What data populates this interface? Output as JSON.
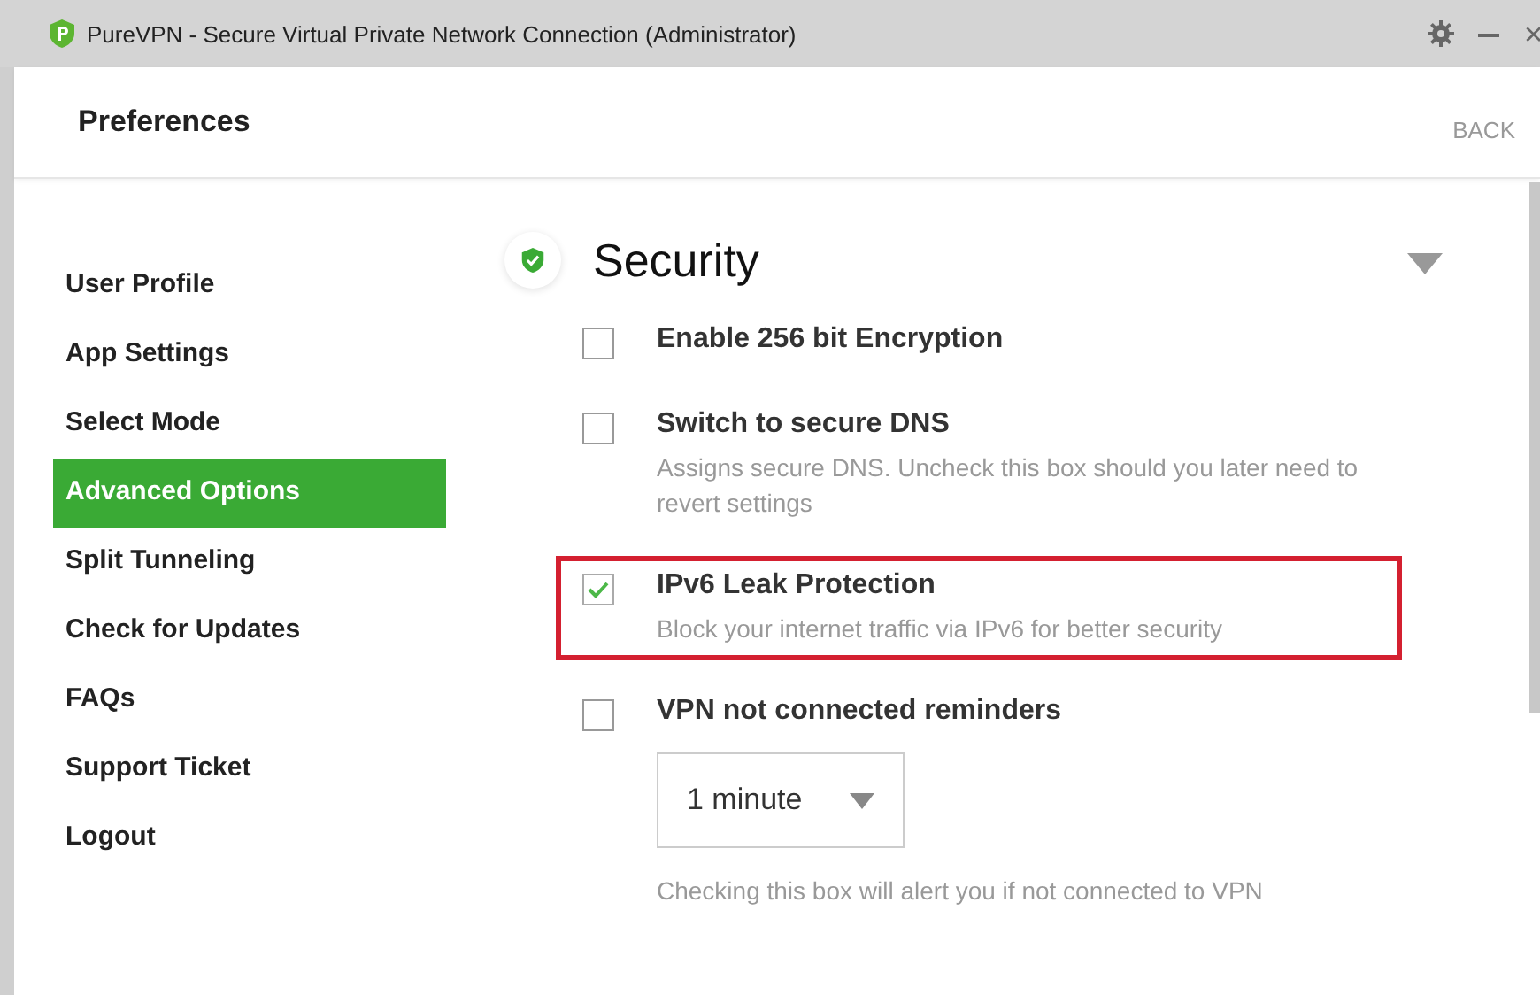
{
  "window": {
    "title": "PureVPN - Secure Virtual Private Network Connection (Administrator)"
  },
  "header": {
    "title": "Preferences",
    "back": "BACK"
  },
  "sidebar": {
    "items": [
      {
        "label": "User Profile",
        "selected": false
      },
      {
        "label": "App Settings",
        "selected": false
      },
      {
        "label": "Select Mode",
        "selected": false
      },
      {
        "label": "Advanced Options",
        "selected": true
      },
      {
        "label": "Split Tunneling",
        "selected": false
      },
      {
        "label": "Check for Updates",
        "selected": false
      },
      {
        "label": "FAQs",
        "selected": false
      },
      {
        "label": "Support Ticket",
        "selected": false
      },
      {
        "label": "Logout",
        "selected": false
      }
    ]
  },
  "section": {
    "title": "Security",
    "expanded": true,
    "options": [
      {
        "label": "Enable 256 bit Encryption",
        "checked": false,
        "highlighted": false
      },
      {
        "label": "Switch to secure DNS",
        "description": "Assigns secure DNS. Uncheck this box should you later need to revert settings",
        "checked": false,
        "highlighted": false
      },
      {
        "label": "IPv6 Leak Protection",
        "description": "Block your internet traffic via IPv6 for better security",
        "checked": true,
        "highlighted": true
      },
      {
        "label": "VPN not connected reminders",
        "dropdown": {
          "value": "1 minute"
        },
        "description": "Checking this box will alert you if not connected to VPN",
        "checked": false,
        "highlighted": false
      }
    ]
  }
}
